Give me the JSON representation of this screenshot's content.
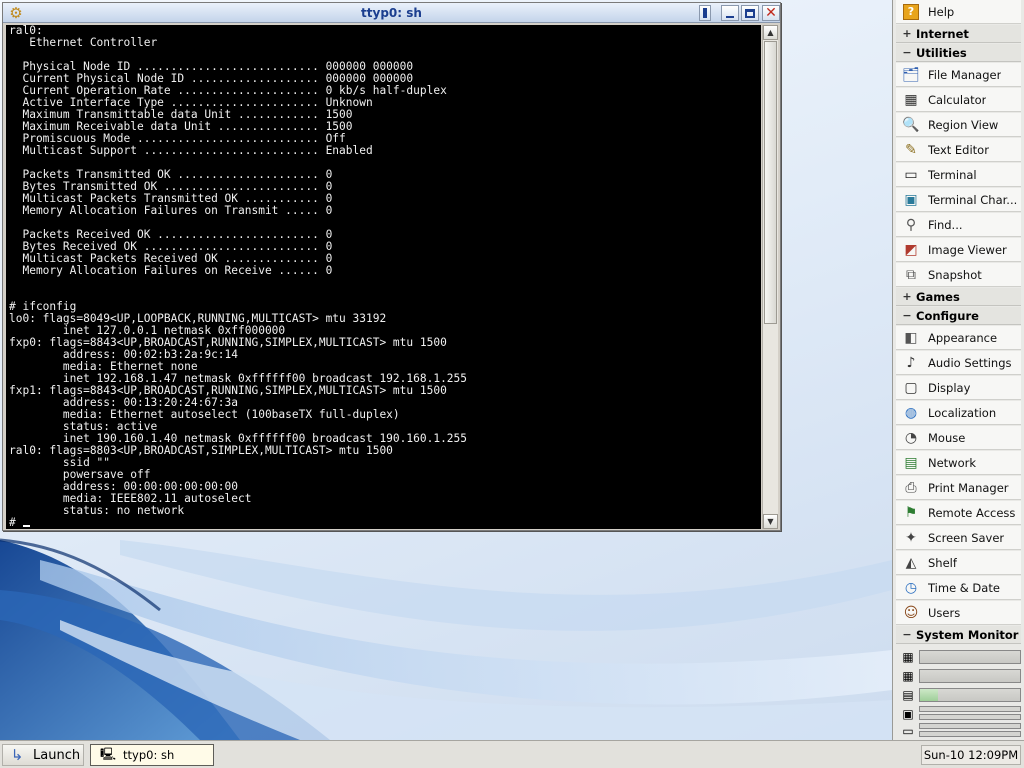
{
  "window": {
    "title": "ttyp0: sh",
    "terminal_output": "ral0:\n   Ethernet Controller\n\n  Physical Node ID ........................... 000000 000000\n  Current Physical Node ID ................... 000000 000000\n  Current Operation Rate ..................... 0 kb/s half-duplex\n  Active Interface Type ...................... Unknown\n  Maximum Transmittable data Unit ............ 1500\n  Maximum Receivable data Unit ............... 1500\n  Promiscuous Mode ........................... Off\n  Multicast Support .......................... Enabled\n\n  Packets Transmitted OK ..................... 0\n  Bytes Transmitted OK ....................... 0\n  Multicast Packets Transmitted OK ........... 0\n  Memory Allocation Failures on Transmit ..... 0\n\n  Packets Received OK ........................ 0\n  Bytes Received OK .......................... 0\n  Multicast Packets Received OK .............. 0\n  Memory Allocation Failures on Receive ...... 0\n\n\n# ifconfig\nlo0: flags=8049<UP,LOOPBACK,RUNNING,MULTICAST> mtu 33192\n        inet 127.0.0.1 netmask 0xff000000\nfxp0: flags=8843<UP,BROADCAST,RUNNING,SIMPLEX,MULTICAST> mtu 1500\n        address: 00:02:b3:2a:9c:14\n        media: Ethernet none\n        inet 192.168.1.47 netmask 0xffffff00 broadcast 192.168.1.255\nfxp1: flags=8843<UP,BROADCAST,RUNNING,SIMPLEX,MULTICAST> mtu 1500\n        address: 00:13:20:24:67:3a\n        media: Ethernet autoselect (100baseTX full-duplex)\n        status: active\n        inet 190.160.1.40 netmask 0xffffff00 broadcast 190.160.1.255\nral0: flags=8803<UP,BROADCAST,SIMPLEX,MULTICAST> mtu 1500\n        ssid \"\"\n        powersave off\n        address: 00:00:00:00:00:00\n        media: IEEE802.11 autoselect\n        status: no network\n# "
  },
  "panel": {
    "help": "Help",
    "sections": {
      "internet": "Internet",
      "utilities": "Utilities",
      "games": "Games",
      "configure": "Configure",
      "system_monitor": "System Monitor"
    },
    "utilities": [
      {
        "label": "File Manager",
        "icon": "file-manager-icon"
      },
      {
        "label": "Calculator",
        "icon": "calculator-icon"
      },
      {
        "label": "Region View",
        "icon": "magnifier-icon"
      },
      {
        "label": "Text Editor",
        "icon": "text-editor-icon"
      },
      {
        "label": "Terminal",
        "icon": "terminal-icon"
      },
      {
        "label": "Terminal Char...",
        "icon": "terminal-charmap-icon"
      },
      {
        "label": "Find...",
        "icon": "find-icon"
      },
      {
        "label": "Image Viewer",
        "icon": "image-viewer-icon"
      },
      {
        "label": "Snapshot",
        "icon": "snapshot-icon"
      }
    ],
    "configure": [
      {
        "label": "Appearance",
        "icon": "appearance-icon"
      },
      {
        "label": "Audio Settings",
        "icon": "audio-icon"
      },
      {
        "label": "Display",
        "icon": "display-icon"
      },
      {
        "label": "Localization",
        "icon": "globe-icon"
      },
      {
        "label": "Mouse",
        "icon": "mouse-icon"
      },
      {
        "label": "Network",
        "icon": "network-icon"
      },
      {
        "label": "Print Manager",
        "icon": "printer-icon"
      },
      {
        "label": "Remote Access",
        "icon": "remote-access-icon"
      },
      {
        "label": "Screen Saver",
        "icon": "screen-saver-icon"
      },
      {
        "label": "Shelf",
        "icon": "shelf-icon"
      },
      {
        "label": "Time & Date",
        "icon": "clock-icon"
      },
      {
        "label": "Users",
        "icon": "users-icon"
      }
    ],
    "monitor": {
      "cpu1_usage": 0,
      "cpu2_usage": 0,
      "memory_usage": 0.18
    }
  },
  "taskbar": {
    "launch_label": "Launch",
    "task_label": "ttyp0: sh",
    "clock": "Sun-10 12:09PM"
  }
}
